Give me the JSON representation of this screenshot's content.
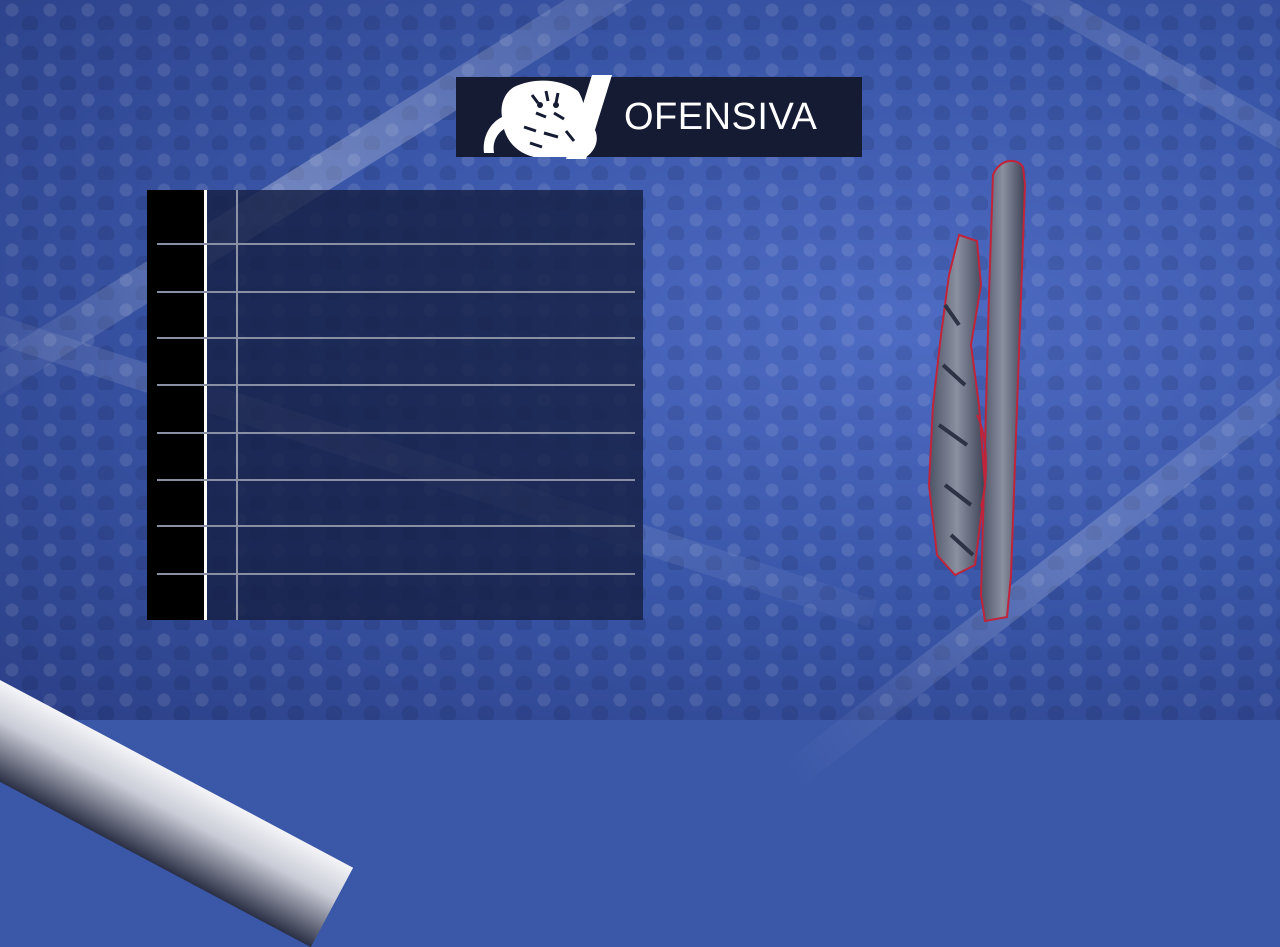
{
  "title": {
    "text": "OFENSIVA",
    "logo_icon": "tiger-logo-icon"
  },
  "roster_panel": {
    "rows": [
      {
        "number": "",
        "name": ""
      },
      {
        "number": "",
        "name": ""
      },
      {
        "number": "",
        "name": ""
      },
      {
        "number": "",
        "name": ""
      },
      {
        "number": "",
        "name": ""
      },
      {
        "number": "",
        "name": ""
      },
      {
        "number": "",
        "name": ""
      },
      {
        "number": "",
        "name": ""
      },
      {
        "number": "",
        "name": ""
      }
    ]
  },
  "emblem_icon": "tiger-4-emblem-icon",
  "colors": {
    "background": "#3a57a8",
    "title_bar": "#151b33",
    "panel": "#162044",
    "emblem_accent": "#c0243a"
  }
}
